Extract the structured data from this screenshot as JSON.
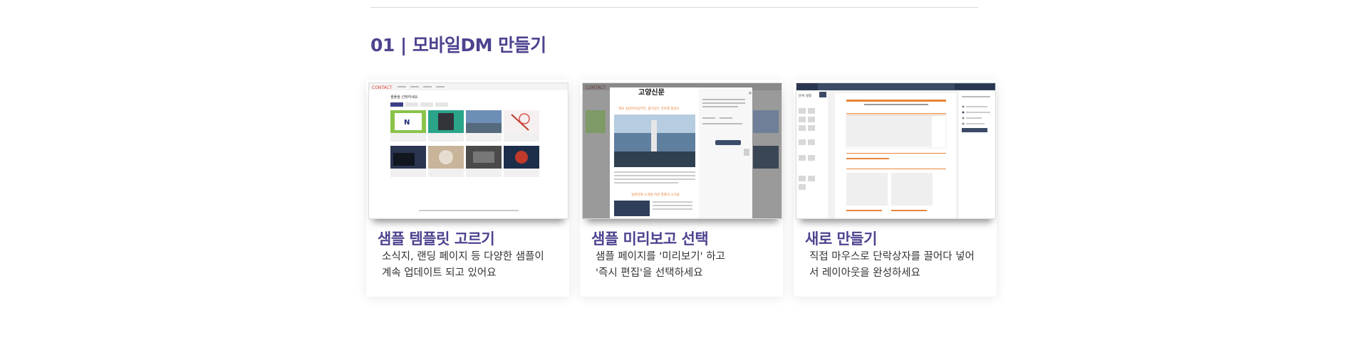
{
  "section": {
    "title": "01 | 모바일DM 만들기"
  },
  "cards": [
    {
      "title": "샘플 템플릿 고르기",
      "desc_line1": "소식지, 랜딩 페이지 등 다양한 샘플이",
      "desc_line2": "계속 업데이트 되고 있어요",
      "screenshot": {
        "logo": "CONTACT",
        "heading": "샘플을 선택하세요"
      }
    },
    {
      "title": "샘플 미리보고 선택",
      "desc_line1": "샘플 페이지를 '미리보기' 하고",
      "desc_line2": "'즉시 편집'을 선택하세요",
      "screenshot": {
        "logo": "CONTACT",
        "newspaper_title": "고양신문",
        "headline": "필요 실내자비용부터, 평가받은 것조를 찾았도",
        "subhead": "실로만에 소개할 지원 열풍의 소식을"
      }
    },
    {
      "title": "새로 만들기",
      "desc_line1": "직접 마우스로 단락상자를 끌어다 넣어",
      "desc_line2": "서 레이아웃을 완성하세요",
      "screenshot": {
        "menu_label": "문서 설정"
      }
    }
  ],
  "colors": {
    "accent": "#4c438f",
    "orange": "#e8833a"
  }
}
